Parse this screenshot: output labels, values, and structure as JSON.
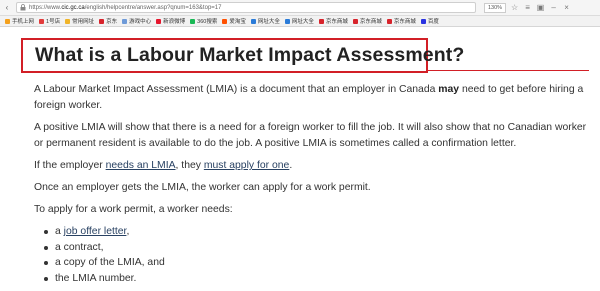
{
  "browser": {
    "url_prefix": "https://www.",
    "url_host": "cic.gc.ca",
    "url_path": "/english/helpcentre/answer.asp?qnum=163&top=17",
    "zoom": "130%",
    "bookmarks": [
      {
        "label": "手机上网",
        "color": "#f4a11d"
      },
      {
        "label": "1号店",
        "color": "#e23b3b"
      },
      {
        "label": "常用网址",
        "color": "#f0b429"
      },
      {
        "label": "京东",
        "color": "#d7232b"
      },
      {
        "label": "游戏中心",
        "color": "#6e9ad8"
      },
      {
        "label": "新浪微博",
        "color": "#e6162d"
      },
      {
        "label": "360搜索",
        "color": "#19b955"
      },
      {
        "label": "爱淘宝",
        "color": "#ff5000"
      },
      {
        "label": "网址大全",
        "color": "#2a7bd8"
      },
      {
        "label": "网址大全",
        "color": "#2a7bd8"
      },
      {
        "label": "京东商城",
        "color": "#d7232b"
      },
      {
        "label": "京东商城",
        "color": "#d7232b"
      },
      {
        "label": "京东商城",
        "color": "#d7232b"
      },
      {
        "label": "百度",
        "color": "#2932e1"
      }
    ]
  },
  "page": {
    "title": "What is a Labour Market Impact Assessment?",
    "accent_color": "#d21f26",
    "link_color": "#284162",
    "p1_text": "A Labour Market Impact Assessment (LMIA) is a document that an employer in Canada ",
    "p1_bold": "may",
    "p1_end": " need to get before hiring a foreign worker.",
    "p2": "A positive LMIA will show that there is a need for a foreign worker to fill the job. It will also show that no Canadian worker or permanent resident is available to do the job. A positive LMIA is sometimes called a confirmation letter.",
    "p3_start": "If the employer ",
    "p3_link1": "needs an LMIA",
    "p3_mid": ", they ",
    "p3_link2": "must apply for one",
    "p3_end": ".",
    "p4": "Once an employer gets the LMIA, the worker can apply for a work permit.",
    "p5": "To apply for a work permit, a worker needs:",
    "list": {
      "item1_pre": "a ",
      "item1_link": "job offer letter",
      "item1_post": ",",
      "item2": "a contract,",
      "item3": "a copy of the LMIA, and",
      "item4": "the LMIA number."
    }
  }
}
